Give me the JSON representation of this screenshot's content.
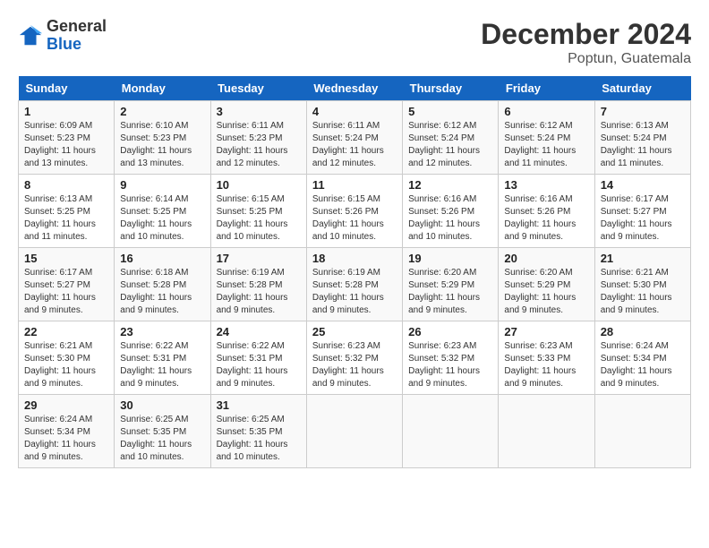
{
  "logo": {
    "general": "General",
    "blue": "Blue"
  },
  "title": "December 2024",
  "location": "Poptun, Guatemala",
  "days_of_week": [
    "Sunday",
    "Monday",
    "Tuesday",
    "Wednesday",
    "Thursday",
    "Friday",
    "Saturday"
  ],
  "weeks": [
    [
      {
        "day": "1",
        "sunrise": "Sunrise: 6:09 AM",
        "sunset": "Sunset: 5:23 PM",
        "daylight": "Daylight: 11 hours and 13 minutes."
      },
      {
        "day": "2",
        "sunrise": "Sunrise: 6:10 AM",
        "sunset": "Sunset: 5:23 PM",
        "daylight": "Daylight: 11 hours and 13 minutes."
      },
      {
        "day": "3",
        "sunrise": "Sunrise: 6:11 AM",
        "sunset": "Sunset: 5:23 PM",
        "daylight": "Daylight: 11 hours and 12 minutes."
      },
      {
        "day": "4",
        "sunrise": "Sunrise: 6:11 AM",
        "sunset": "Sunset: 5:24 PM",
        "daylight": "Daylight: 11 hours and 12 minutes."
      },
      {
        "day": "5",
        "sunrise": "Sunrise: 6:12 AM",
        "sunset": "Sunset: 5:24 PM",
        "daylight": "Daylight: 11 hours and 12 minutes."
      },
      {
        "day": "6",
        "sunrise": "Sunrise: 6:12 AM",
        "sunset": "Sunset: 5:24 PM",
        "daylight": "Daylight: 11 hours and 11 minutes."
      },
      {
        "day": "7",
        "sunrise": "Sunrise: 6:13 AM",
        "sunset": "Sunset: 5:24 PM",
        "daylight": "Daylight: 11 hours and 11 minutes."
      }
    ],
    [
      {
        "day": "8",
        "sunrise": "Sunrise: 6:13 AM",
        "sunset": "Sunset: 5:25 PM",
        "daylight": "Daylight: 11 hours and 11 minutes."
      },
      {
        "day": "9",
        "sunrise": "Sunrise: 6:14 AM",
        "sunset": "Sunset: 5:25 PM",
        "daylight": "Daylight: 11 hours and 10 minutes."
      },
      {
        "day": "10",
        "sunrise": "Sunrise: 6:15 AM",
        "sunset": "Sunset: 5:25 PM",
        "daylight": "Daylight: 11 hours and 10 minutes."
      },
      {
        "day": "11",
        "sunrise": "Sunrise: 6:15 AM",
        "sunset": "Sunset: 5:26 PM",
        "daylight": "Daylight: 11 hours and 10 minutes."
      },
      {
        "day": "12",
        "sunrise": "Sunrise: 6:16 AM",
        "sunset": "Sunset: 5:26 PM",
        "daylight": "Daylight: 11 hours and 10 minutes."
      },
      {
        "day": "13",
        "sunrise": "Sunrise: 6:16 AM",
        "sunset": "Sunset: 5:26 PM",
        "daylight": "Daylight: 11 hours and 9 minutes."
      },
      {
        "day": "14",
        "sunrise": "Sunrise: 6:17 AM",
        "sunset": "Sunset: 5:27 PM",
        "daylight": "Daylight: 11 hours and 9 minutes."
      }
    ],
    [
      {
        "day": "15",
        "sunrise": "Sunrise: 6:17 AM",
        "sunset": "Sunset: 5:27 PM",
        "daylight": "Daylight: 11 hours and 9 minutes."
      },
      {
        "day": "16",
        "sunrise": "Sunrise: 6:18 AM",
        "sunset": "Sunset: 5:28 PM",
        "daylight": "Daylight: 11 hours and 9 minutes."
      },
      {
        "day": "17",
        "sunrise": "Sunrise: 6:19 AM",
        "sunset": "Sunset: 5:28 PM",
        "daylight": "Daylight: 11 hours and 9 minutes."
      },
      {
        "day": "18",
        "sunrise": "Sunrise: 6:19 AM",
        "sunset": "Sunset: 5:28 PM",
        "daylight": "Daylight: 11 hours and 9 minutes."
      },
      {
        "day": "19",
        "sunrise": "Sunrise: 6:20 AM",
        "sunset": "Sunset: 5:29 PM",
        "daylight": "Daylight: 11 hours and 9 minutes."
      },
      {
        "day": "20",
        "sunrise": "Sunrise: 6:20 AM",
        "sunset": "Sunset: 5:29 PM",
        "daylight": "Daylight: 11 hours and 9 minutes."
      },
      {
        "day": "21",
        "sunrise": "Sunrise: 6:21 AM",
        "sunset": "Sunset: 5:30 PM",
        "daylight": "Daylight: 11 hours and 9 minutes."
      }
    ],
    [
      {
        "day": "22",
        "sunrise": "Sunrise: 6:21 AM",
        "sunset": "Sunset: 5:30 PM",
        "daylight": "Daylight: 11 hours and 9 minutes."
      },
      {
        "day": "23",
        "sunrise": "Sunrise: 6:22 AM",
        "sunset": "Sunset: 5:31 PM",
        "daylight": "Daylight: 11 hours and 9 minutes."
      },
      {
        "day": "24",
        "sunrise": "Sunrise: 6:22 AM",
        "sunset": "Sunset: 5:31 PM",
        "daylight": "Daylight: 11 hours and 9 minutes."
      },
      {
        "day": "25",
        "sunrise": "Sunrise: 6:23 AM",
        "sunset": "Sunset: 5:32 PM",
        "daylight": "Daylight: 11 hours and 9 minutes."
      },
      {
        "day": "26",
        "sunrise": "Sunrise: 6:23 AM",
        "sunset": "Sunset: 5:32 PM",
        "daylight": "Daylight: 11 hours and 9 minutes."
      },
      {
        "day": "27",
        "sunrise": "Sunrise: 6:23 AM",
        "sunset": "Sunset: 5:33 PM",
        "daylight": "Daylight: 11 hours and 9 minutes."
      },
      {
        "day": "28",
        "sunrise": "Sunrise: 6:24 AM",
        "sunset": "Sunset: 5:34 PM",
        "daylight": "Daylight: 11 hours and 9 minutes."
      }
    ],
    [
      {
        "day": "29",
        "sunrise": "Sunrise: 6:24 AM",
        "sunset": "Sunset: 5:34 PM",
        "daylight": "Daylight: 11 hours and 9 minutes."
      },
      {
        "day": "30",
        "sunrise": "Sunrise: 6:25 AM",
        "sunset": "Sunset: 5:35 PM",
        "daylight": "Daylight: 11 hours and 10 minutes."
      },
      {
        "day": "31",
        "sunrise": "Sunrise: 6:25 AM",
        "sunset": "Sunset: 5:35 PM",
        "daylight": "Daylight: 11 hours and 10 minutes."
      },
      null,
      null,
      null,
      null
    ]
  ]
}
